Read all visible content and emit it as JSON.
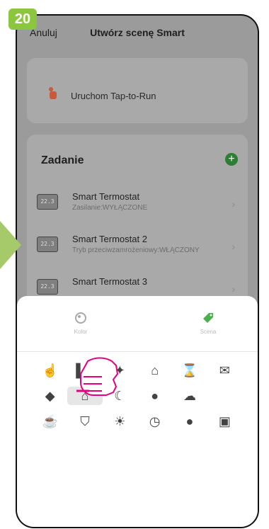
{
  "step_badge": "20",
  "header": {
    "cancel_label": "Anuluj",
    "title": "Utwórz scenę Smart"
  },
  "tap_to_run": {
    "label": "Uruchom Tap-to-Run",
    "icon": "hand-tap-icon"
  },
  "task_section": {
    "heading": "Zadanie",
    "add_icon": "plus-circle-icon",
    "rows": [
      {
        "thumb": "22.3",
        "name": "Smart Termostat",
        "detail": "Zasilanie:WYŁĄCZONE"
      },
      {
        "thumb": "22.3",
        "name": "Smart Termostat 2",
        "detail": "Tryb przeciwzamrożeniowy:WŁĄCZONY"
      },
      {
        "thumb": "22.3",
        "name": "Smart Termostat 3",
        "detail": ""
      }
    ]
  },
  "sheet": {
    "tabs": [
      {
        "label": "Kolor",
        "icon": "palette-icon"
      },
      {
        "label": "Scena",
        "icon": "tag-icon"
      }
    ],
    "icons": [
      "hand-tap-icon",
      "curtains-icon",
      "leaf-icon",
      "walking-person-home-icon",
      "hourglass-icon",
      "envelope-icon",
      "tag-icon",
      "walking-person-home-icon",
      "moon-icon",
      "location-pin-icon",
      "rain-cloud-icon",
      "cup-icon",
      "shield-icon",
      "sun-icon",
      "clock-icon",
      "drop-icon",
      "briefcase-icon"
    ],
    "selected_icon_index": 7
  },
  "colors": {
    "accent": "#2e7d32",
    "badge": "#8cc63e"
  }
}
